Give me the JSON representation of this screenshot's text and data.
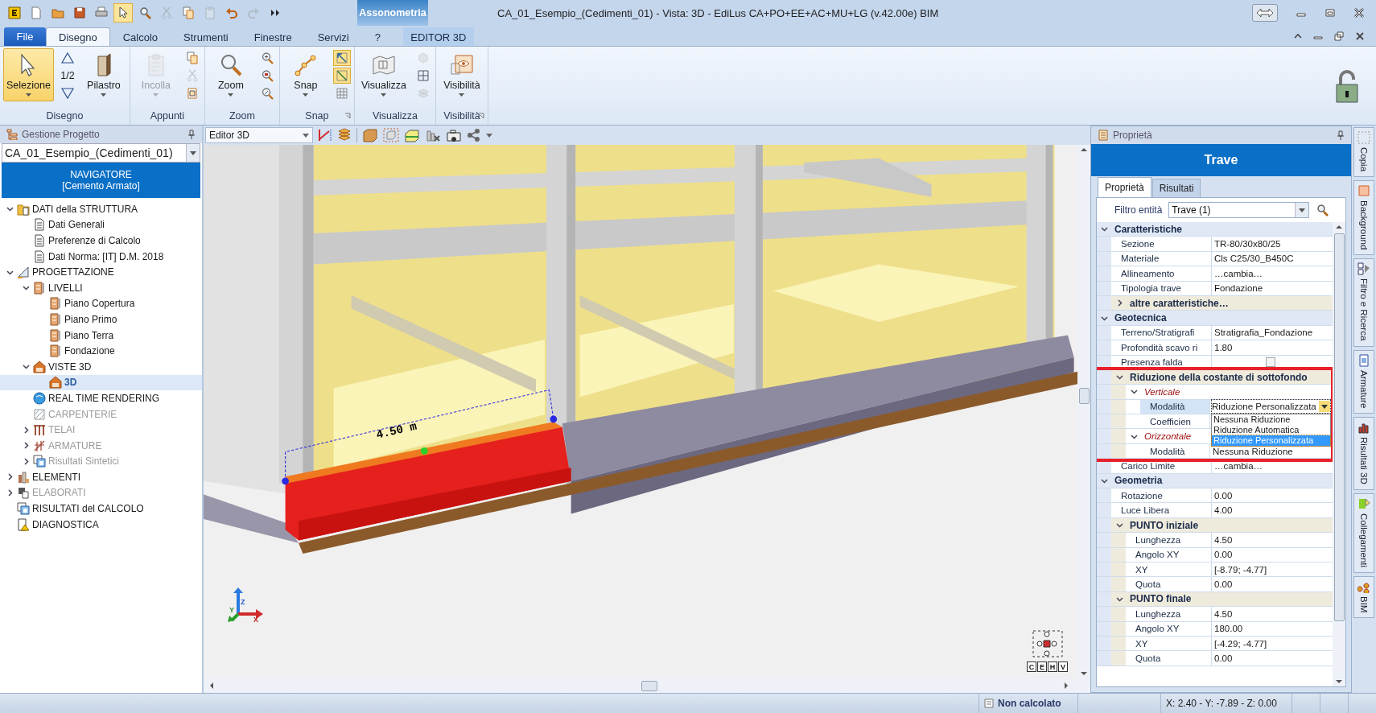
{
  "title_bar": {
    "title": "CA_01_Esempio_(Cedimenti_01) -  Vista: 3D - EdiLus CA+PO+EE+AC+MU+LG (v.42.00e) BIM",
    "context_group": "Assonometria",
    "quick_access": [
      {
        "selected": false,
        "disabled": false
      },
      {
        "selected": false,
        "disabled": false
      },
      {
        "selected": false,
        "disabled": false
      },
      {
        "selected": false,
        "disabled": false
      },
      {
        "selected": false,
        "disabled": false
      },
      {
        "selected": true,
        "disabled": false
      },
      {
        "selected": false,
        "disabled": false
      },
      {
        "selected": false,
        "disabled": true
      },
      {
        "selected": false,
        "disabled": false
      },
      {
        "selected": false,
        "disabled": true
      },
      {
        "selected": false,
        "disabled": false
      },
      {
        "selected": false,
        "disabled": true
      },
      {
        "selected": false,
        "disabled": false
      }
    ]
  },
  "menu_tabs": [
    {
      "label": "File",
      "kind": "file",
      "selected": false
    },
    {
      "label": "Disegno",
      "kind": "tab",
      "selected": true
    },
    {
      "label": "Calcolo",
      "kind": "tab",
      "selected": false
    },
    {
      "label": "Strumenti",
      "kind": "tab",
      "selected": false
    },
    {
      "label": "Finestre",
      "kind": "tab",
      "selected": false
    },
    {
      "label": "Servizi",
      "kind": "tab",
      "selected": false
    },
    {
      "label": "?",
      "kind": "tab",
      "selected": false
    },
    {
      "label": "EDITOR 3D",
      "kind": "context",
      "selected": false
    }
  ],
  "ribbon": [
    {
      "label": "Disegno",
      "launcher": false,
      "controls": [
        {
          "kind": "large",
          "label": "Selezione",
          "selected": true,
          "disabled": false
        },
        {
          "kind": "column",
          "items": [
            {
              "kind": "small",
              "selected": false,
              "disabled": false
            },
            {
              "kind": "text",
              "label": "1/2"
            },
            {
              "kind": "small",
              "selected": false,
              "disabled": false
            }
          ]
        },
        {
          "kind": "large",
          "label": "Pilastro",
          "selected": false,
          "disabled": false
        }
      ]
    },
    {
      "label": "Appunti",
      "launcher": false,
      "controls": [
        {
          "kind": "large",
          "label": "Incolla",
          "selected": false,
          "disabled": true
        },
        {
          "kind": "column",
          "items": [
            {
              "kind": "small",
              "selected": false,
              "disabled": false
            },
            {
              "kind": "small",
              "selected": false,
              "disabled": true
            },
            {
              "kind": "small",
              "selected": false,
              "disabled": false
            }
          ]
        }
      ]
    },
    {
      "label": "Zoom",
      "launcher": false,
      "controls": [
        {
          "kind": "large",
          "label": "Zoom",
          "selected": false,
          "disabled": false
        },
        {
          "kind": "column",
          "items": [
            {
              "kind": "small",
              "selected": false,
              "disabled": false
            },
            {
              "kind": "small",
              "selected": false,
              "disabled": false
            },
            {
              "kind": "small",
              "selected": false,
              "disabled": false
            }
          ]
        }
      ]
    },
    {
      "label": "Snap",
      "launcher": true,
      "controls": [
        {
          "kind": "large",
          "label": "Snap",
          "selected": false,
          "disabled": false
        },
        {
          "kind": "column",
          "items": [
            {
              "kind": "small",
              "selected": true,
              "disabled": false
            },
            {
              "kind": "small",
              "selected": true,
              "disabled": false
            },
            {
              "kind": "small",
              "selected": false,
              "disabled": false
            }
          ]
        }
      ]
    },
    {
      "label": "Visualizza",
      "launcher": false,
      "controls": [
        {
          "kind": "large",
          "label": "Visualizza",
          "selected": false,
          "disabled": false
        },
        {
          "kind": "column",
          "items": [
            {
              "kind": "small",
              "selected": false,
              "disabled": true
            },
            {
              "kind": "small",
              "selected": false,
              "disabled": false
            },
            {
              "kind": "small",
              "selected": false,
              "disabled": true
            }
          ]
        }
      ]
    },
    {
      "label": "Visibilità",
      "launcher": true,
      "controls": [
        {
          "kind": "large",
          "label": "Visibilità",
          "selected": false,
          "disabled": false
        }
      ]
    }
  ],
  "project_panel": {
    "header": "Gestione Progetto",
    "project": "CA_01_Esempio_(Cedimenti_01)",
    "navigator_title": "NAVIGATORE",
    "navigator_subtitle": "[Cemento Armato]",
    "tree": [
      {
        "label": "DATI della STRUTTURA",
        "kind": "data",
        "expanded": true,
        "disabled": false,
        "selected": false,
        "children": [
          {
            "label": "Dati Generali",
            "kind": "doc",
            "disabled": false,
            "selected": false
          },
          {
            "label": "Preferenze di Calcolo",
            "kind": "doc",
            "disabled": false,
            "selected": false
          },
          {
            "label": "Dati Norma: [IT] D.M. 2018",
            "kind": "doc",
            "disabled": false,
            "selected": false
          }
        ]
      },
      {
        "label": "PROGETTAZIONE",
        "kind": "design",
        "expanded": true,
        "disabled": false,
        "selected": false,
        "children": [
          {
            "label": "LIVELLI",
            "kind": "level",
            "expanded": true,
            "disabled": false,
            "selected": false,
            "children": [
              {
                "label": "Piano Copertura",
                "kind": "level",
                "disabled": false,
                "selected": false
              },
              {
                "label": "Piano Primo",
                "kind": "level",
                "disabled": false,
                "selected": false
              },
              {
                "label": "Piano Terra",
                "kind": "level",
                "disabled": false,
                "selected": false
              },
              {
                "label": "Fondazione",
                "kind": "level",
                "disabled": false,
                "selected": false
              }
            ]
          },
          {
            "label": "VISTE 3D",
            "kind": "view3d",
            "expanded": true,
            "disabled": false,
            "selected": false,
            "children": [
              {
                "label": "3D",
                "kind": "view3d",
                "disabled": false,
                "selected": true
              }
            ]
          },
          {
            "label": "REAL TIME RENDERING",
            "kind": "render",
            "disabled": false,
            "selected": false
          },
          {
            "label": "CARPENTERIE",
            "kind": "carpentry",
            "disabled": true,
            "selected": false
          },
          {
            "label": "TELAI",
            "kind": "frame",
            "expanded": false,
            "disabled": true,
            "selected": false
          },
          {
            "label": "ARMATURE",
            "kind": "rebar",
            "expanded": false,
            "disabled": true,
            "selected": false
          },
          {
            "label": "Risultati Sintetici",
            "kind": "results",
            "expanded": false,
            "disabled": true,
            "selected": false
          }
        ]
      },
      {
        "label": "ELEMENTI",
        "kind": "elements",
        "expanded": false,
        "disabled": false,
        "selected": false
      },
      {
        "label": "ELABORATI",
        "kind": "drawings",
        "expanded": false,
        "disabled": true,
        "selected": false
      },
      {
        "label": "RISULTATI del CALCOLO",
        "kind": "results",
        "disabled": false,
        "selected": false
      },
      {
        "label": "DIAGNOSTICA",
        "kind": "diagnostic",
        "disabled": false,
        "selected": false
      }
    ]
  },
  "viewport": {
    "view": "Editor 3D",
    "dimension": "4.50 m",
    "axis_labels": [
      "Z",
      "Y",
      "X"
    ],
    "view_modes": [
      "C",
      "E",
      "H",
      "V"
    ]
  },
  "properties": {
    "header": "Proprietà",
    "title": "Trave",
    "tabs": [
      {
        "label": "Proprietà",
        "selected": true
      },
      {
        "label": "Risultati",
        "selected": false
      }
    ],
    "filter": {
      "label": "Filtro entità",
      "value": "Trave (1)"
    },
    "sections": [
      {
        "label": "Caratteristiche",
        "expanded": true,
        "items": [
          {
            "kind": "row",
            "name": "Sezione",
            "value": "TR-80/30x80/25"
          },
          {
            "kind": "row",
            "name": "Materiale",
            "value": "Cls C25/30_B450C"
          },
          {
            "kind": "row",
            "name": "Allineamento",
            "value": "…cambia…"
          },
          {
            "kind": "row",
            "name": "Tipologia trave",
            "value": "Fondazione"
          },
          {
            "kind": "group",
            "label": "altre caratteristiche…",
            "expanded": false,
            "highlighted": false
          }
        ]
      },
      {
        "label": "Geotecnica",
        "expanded": true,
        "items": [
          {
            "kind": "row",
            "name": "Terreno/Stratigrafi",
            "value": "Stratigrafia_Fondazione"
          },
          {
            "kind": "row",
            "name": "Profondità scavo ri",
            "value": "1.80"
          },
          {
            "kind": "checkbox",
            "name": "Presenza falda",
            "checked": false
          },
          {
            "kind": "group",
            "label": "Riduzione della costante di sottofondo",
            "expanded": true,
            "highlighted": true,
            "items": [
              {
                "kind": "subgroup",
                "label": "Verticale",
                "expanded": true,
                "items": [
                  {
                    "kind": "dropdown",
                    "name": "Modalità",
                    "value": "Riduzione Personalizzata",
                    "selected": true,
                    "open": true,
                    "options": [
                      {
                        "label": "Nessuna Riduzione",
                        "selected": false
                      },
                      {
                        "label": "Riduzione Automatica",
                        "selected": false
                      },
                      {
                        "label": "Riduzione Personalizzata",
                        "selected": true
                      }
                    ]
                  },
                  {
                    "kind": "row",
                    "name": "Coefficien"
                  }
                ]
              },
              {
                "kind": "subgroup",
                "label": "Orizzontale",
                "expanded": true,
                "items": [
                  {
                    "kind": "row",
                    "name": "Modalità",
                    "value": "Nessuna Riduzione"
                  }
                ]
              }
            ]
          },
          {
            "kind": "row",
            "name": "Carico Limite",
            "value": "…cambia…"
          }
        ]
      },
      {
        "label": "Geometria",
        "expanded": true,
        "items": [
          {
            "kind": "row",
            "name": "Rotazione",
            "value": "0.00"
          },
          {
            "kind": "row",
            "name": "Luce Libera",
            "value": "4.00"
          },
          {
            "kind": "group",
            "label": "PUNTO iniziale",
            "expanded": true,
            "highlighted": false,
            "items": [
              {
                "kind": "row",
                "name": "Lunghezza",
                "value": "4.50"
              },
              {
                "kind": "row",
                "name": "Angolo XY",
                "value": "0.00"
              },
              {
                "kind": "row",
                "name": "XY",
                "value": "[-8.79; -4.77]"
              },
              {
                "kind": "row",
                "name": "Quota",
                "value": "0.00"
              }
            ]
          },
          {
            "kind": "group",
            "label": "PUNTO finale",
            "expanded": true,
            "highlighted": false,
            "items": [
              {
                "kind": "row",
                "name": "Lunghezza",
                "value": "4.50"
              },
              {
                "kind": "row",
                "name": "Angolo XY",
                "value": "180.00"
              },
              {
                "kind": "row",
                "name": "XY",
                "value": "[-4.29; -4.77]"
              },
              {
                "kind": "row",
                "name": "Quota",
                "value": "0.00"
              }
            ]
          }
        ]
      }
    ]
  },
  "side_tabs": [
    "Copia",
    "Background",
    "Filtro e Ricerca",
    "Armature",
    "Risultati 3D",
    "Collegamenti",
    "BIM"
  ],
  "status_bar": {
    "state": "Non calcolato",
    "coordinates": "X: 2.40 - Y: -7.89 - Z: 0.00"
  }
}
